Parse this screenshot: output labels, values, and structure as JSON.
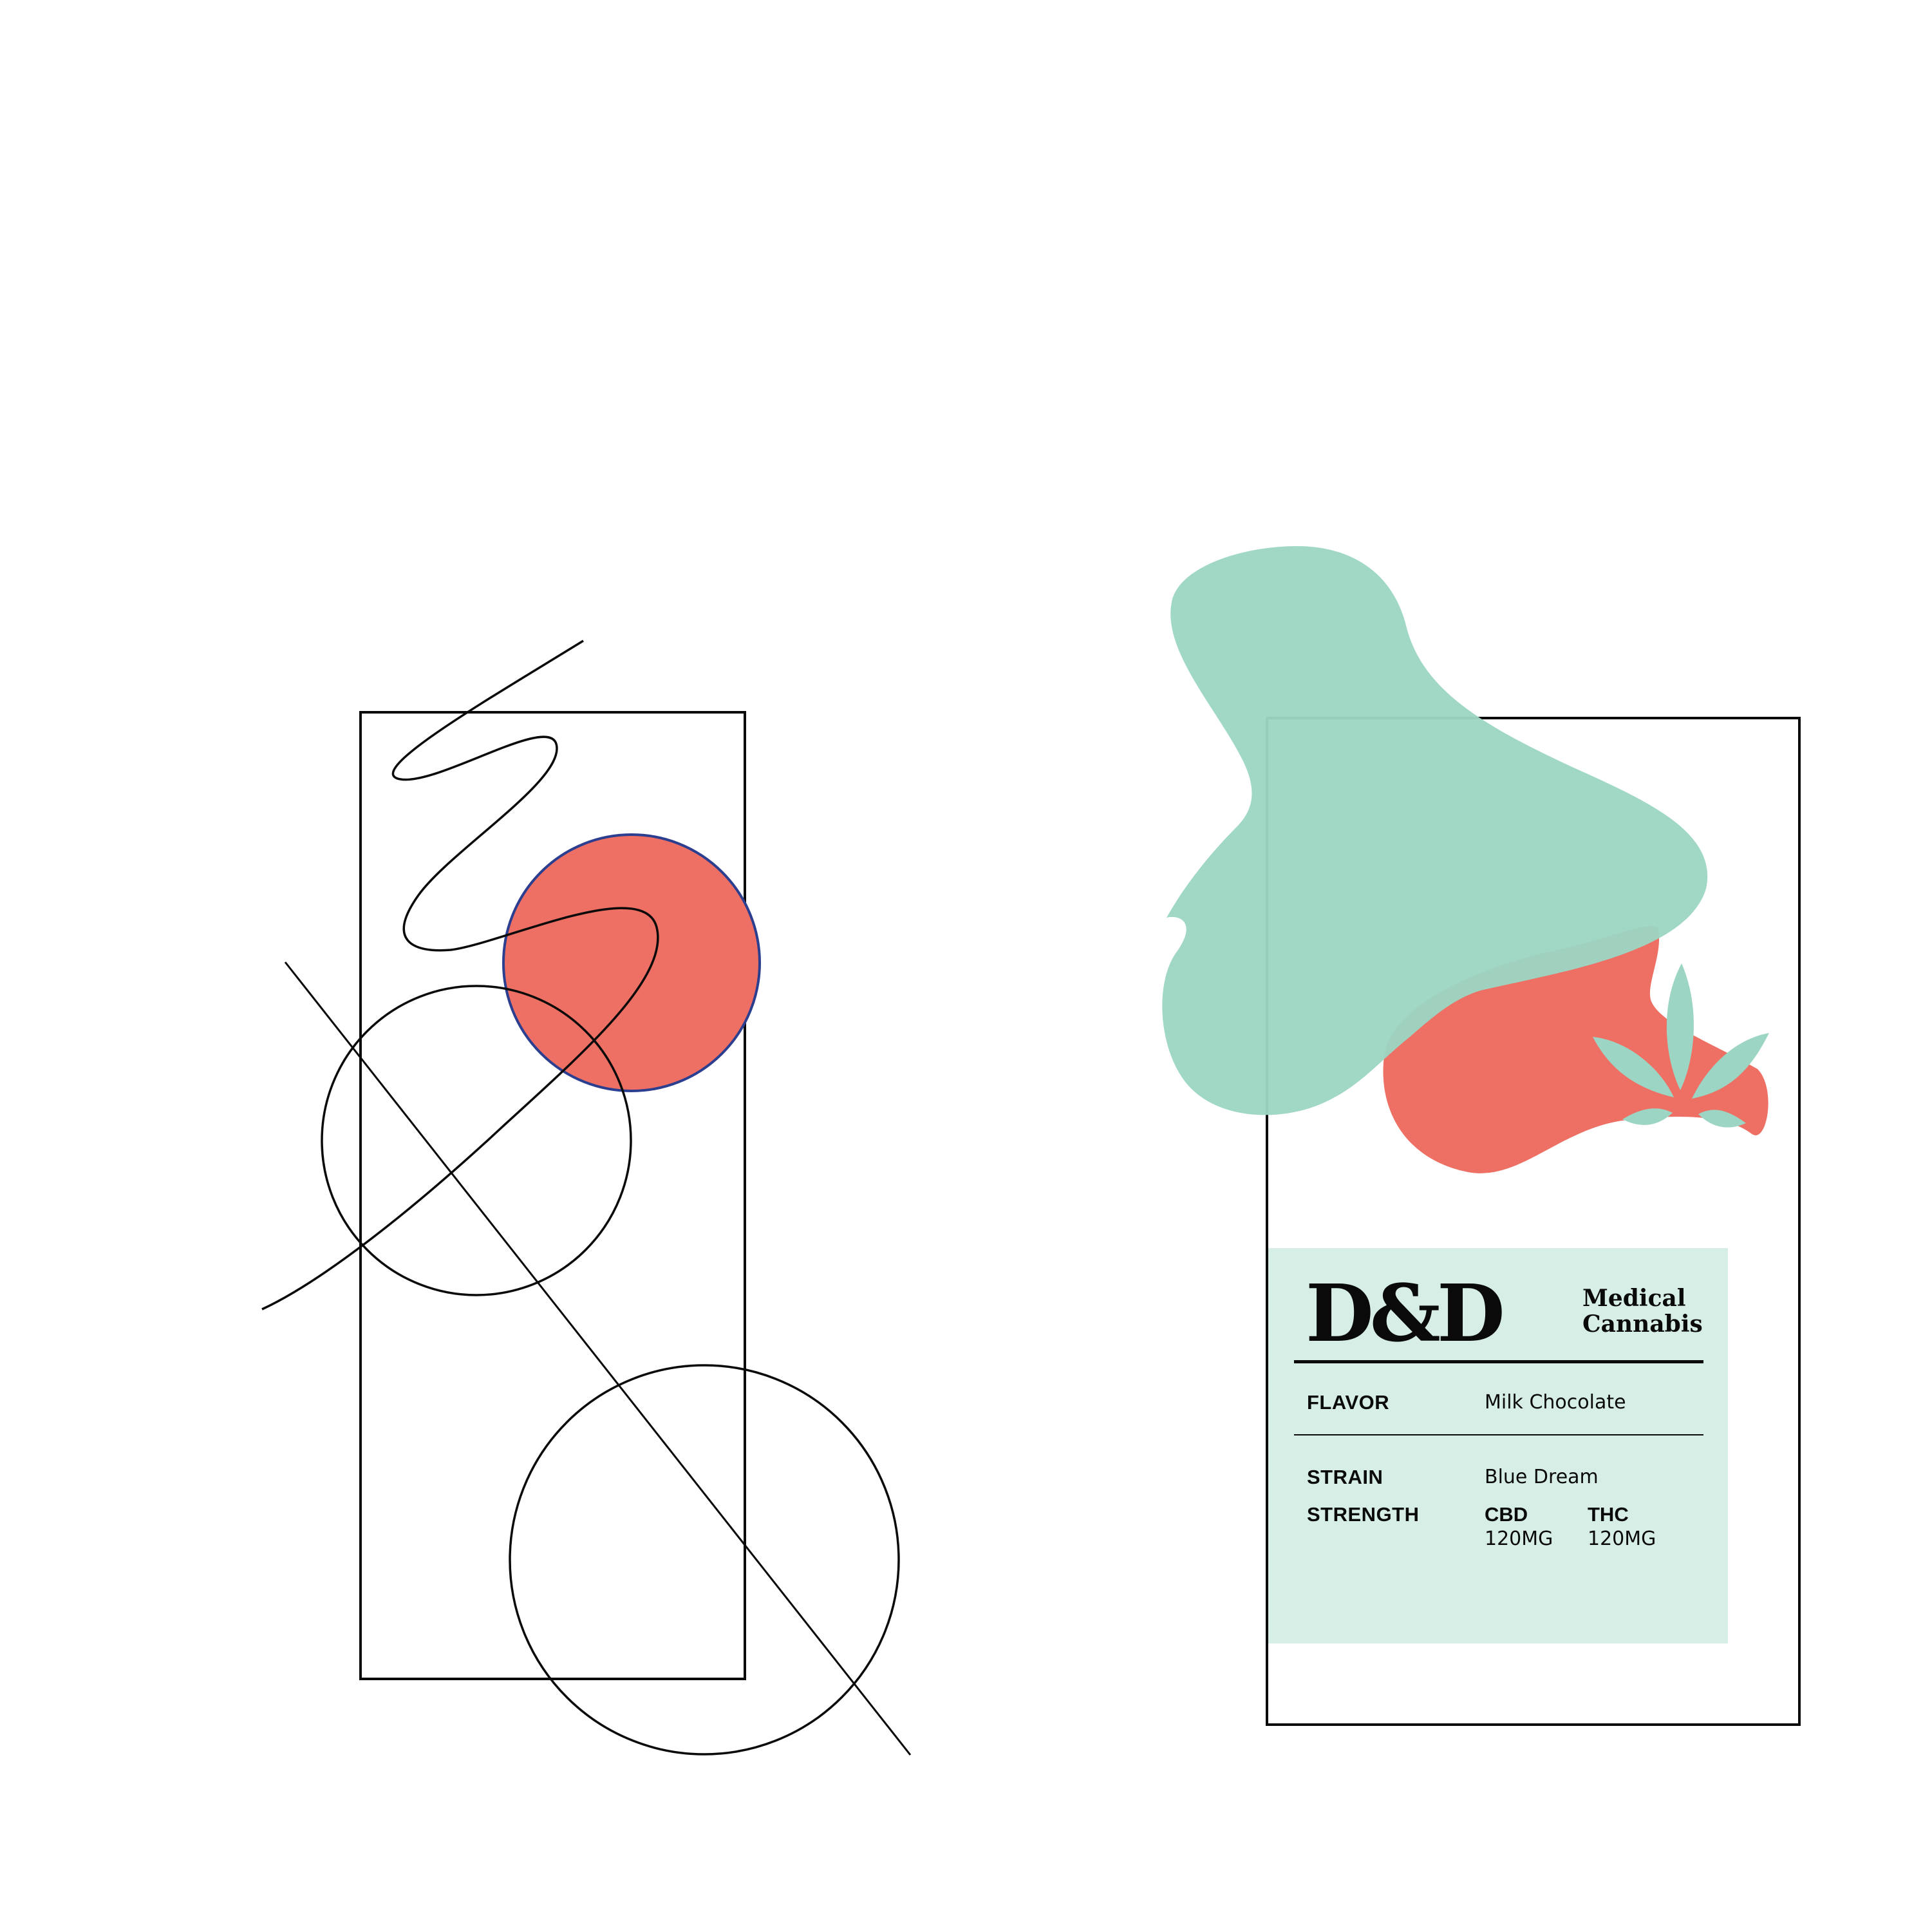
{
  "colors": {
    "coral": "#EE6F63",
    "mint": "#9CD5C3",
    "mint_light": "#D7EEE6",
    "outline_blue": "#2B3E8F",
    "ink": "#0A0A0A"
  },
  "label": {
    "brand": "D&D",
    "subtitle_line1": "Medical",
    "subtitle_line2": "Cannabis",
    "flavor_key": "FLAVOR",
    "flavor_value": "Milk Chocolate",
    "strain_key": "STRAIN",
    "strain_value": "Blue Dream",
    "strength_key": "STRENGTH",
    "cbd_label": "CBD",
    "cbd_value": "120MG",
    "thc_label": "THC",
    "thc_value": "120MG"
  },
  "icons": {
    "logo_mark": "cannabis-leaf-icon"
  }
}
